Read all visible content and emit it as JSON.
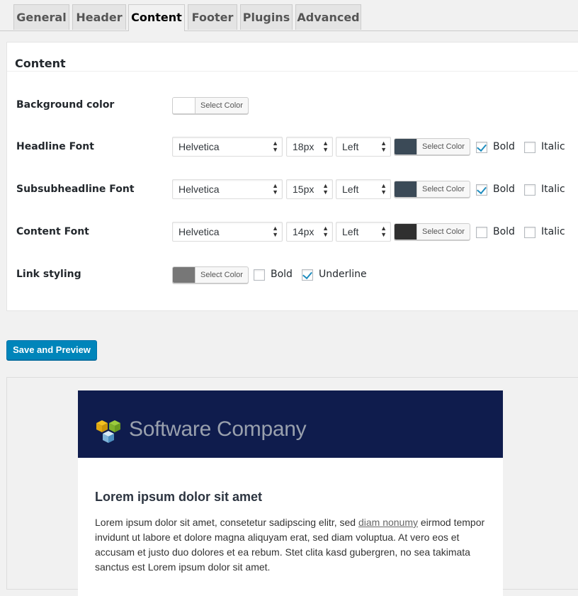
{
  "tabs": [
    {
      "label": "General",
      "active": false
    },
    {
      "label": "Header",
      "active": false
    },
    {
      "label": "Content",
      "active": true
    },
    {
      "label": "Footer",
      "active": false
    },
    {
      "label": "Plugins",
      "active": false
    },
    {
      "label": "Advanced",
      "active": false
    }
  ],
  "panel": {
    "title": "Content",
    "select_color_label": "Select Color",
    "rows": {
      "background": {
        "label": "Background color",
        "color": "#ffffff"
      },
      "headline": {
        "label": "Headline Font",
        "font": "Helvetica",
        "size": "18px",
        "align": "Left",
        "color": "#3b4a57",
        "bold_label": "Bold",
        "bold": true,
        "italic_label": "Italic",
        "italic": false
      },
      "subsub": {
        "label": "Subsubheadline Font",
        "font": "Helvetica",
        "size": "15px",
        "align": "Left",
        "color": "#3b4a57",
        "bold_label": "Bold",
        "bold": true,
        "italic_label": "Italic",
        "italic": false
      },
      "content": {
        "label": "Content Font",
        "font": "Helvetica",
        "size": "14px",
        "align": "Left",
        "color": "#2f2f2f",
        "bold_label": "Bold",
        "bold": false,
        "italic_label": "Italic",
        "italic": false
      },
      "link": {
        "label": "Link styling",
        "color": "#777777",
        "bold_label": "Bold",
        "bold": false,
        "underline_label": "Underline",
        "underline": true
      }
    }
  },
  "save_button": "Save and Preview",
  "preview": {
    "company_name": "Software Company",
    "header_bg": "#0f1c4d",
    "headline": "Lorem ipsum dolor sit amet",
    "para_before_link": "Lorem ipsum dolor sit amet, consetetur sadipscing elitr, sed ",
    "link_text": "diam nonumy",
    "para_after_link": " eirmod tempor invidunt ut labore et dolore magna aliquyam erat, sed diam voluptua. At vero eos et accusam et justo duo dolores et ea rebum. Stet clita kasd gubergren, no sea takimata sanctus est Lorem ipsum dolor sit amet."
  }
}
